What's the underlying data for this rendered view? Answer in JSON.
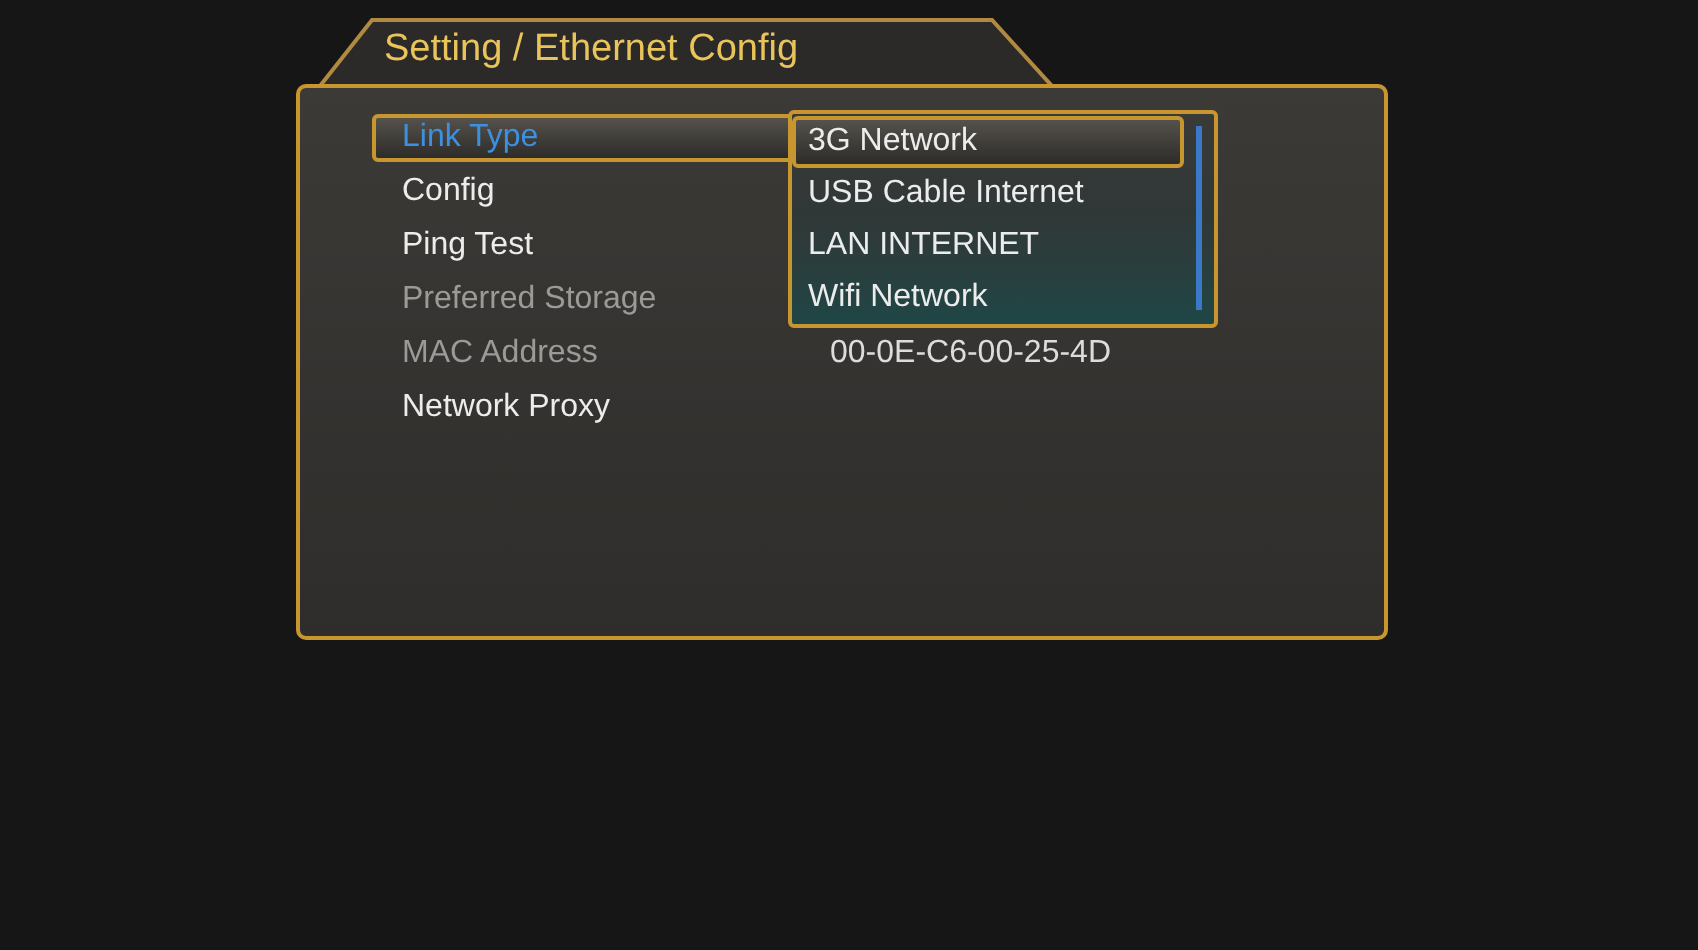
{
  "title": "Setting / Ethernet Config",
  "menu": [
    {
      "label": "Link Type",
      "selected": true,
      "disabled": false
    },
    {
      "label": "Config",
      "selected": false,
      "disabled": false
    },
    {
      "label": "Ping Test",
      "selected": false,
      "disabled": false
    },
    {
      "label": "Preferred Storage",
      "selected": false,
      "disabled": true
    },
    {
      "label": "MAC Address",
      "selected": false,
      "disabled": true,
      "value": "00-0E-C6-00-25-4D"
    },
    {
      "label": "Network Proxy",
      "selected": false,
      "disabled": false
    }
  ],
  "dropdown": {
    "options": [
      {
        "label": "3G Network",
        "selected": true
      },
      {
        "label": "USB Cable Internet",
        "selected": false
      },
      {
        "label": "LAN INTERNET",
        "selected": false
      },
      {
        "label": "Wifi Network",
        "selected": false
      }
    ]
  }
}
